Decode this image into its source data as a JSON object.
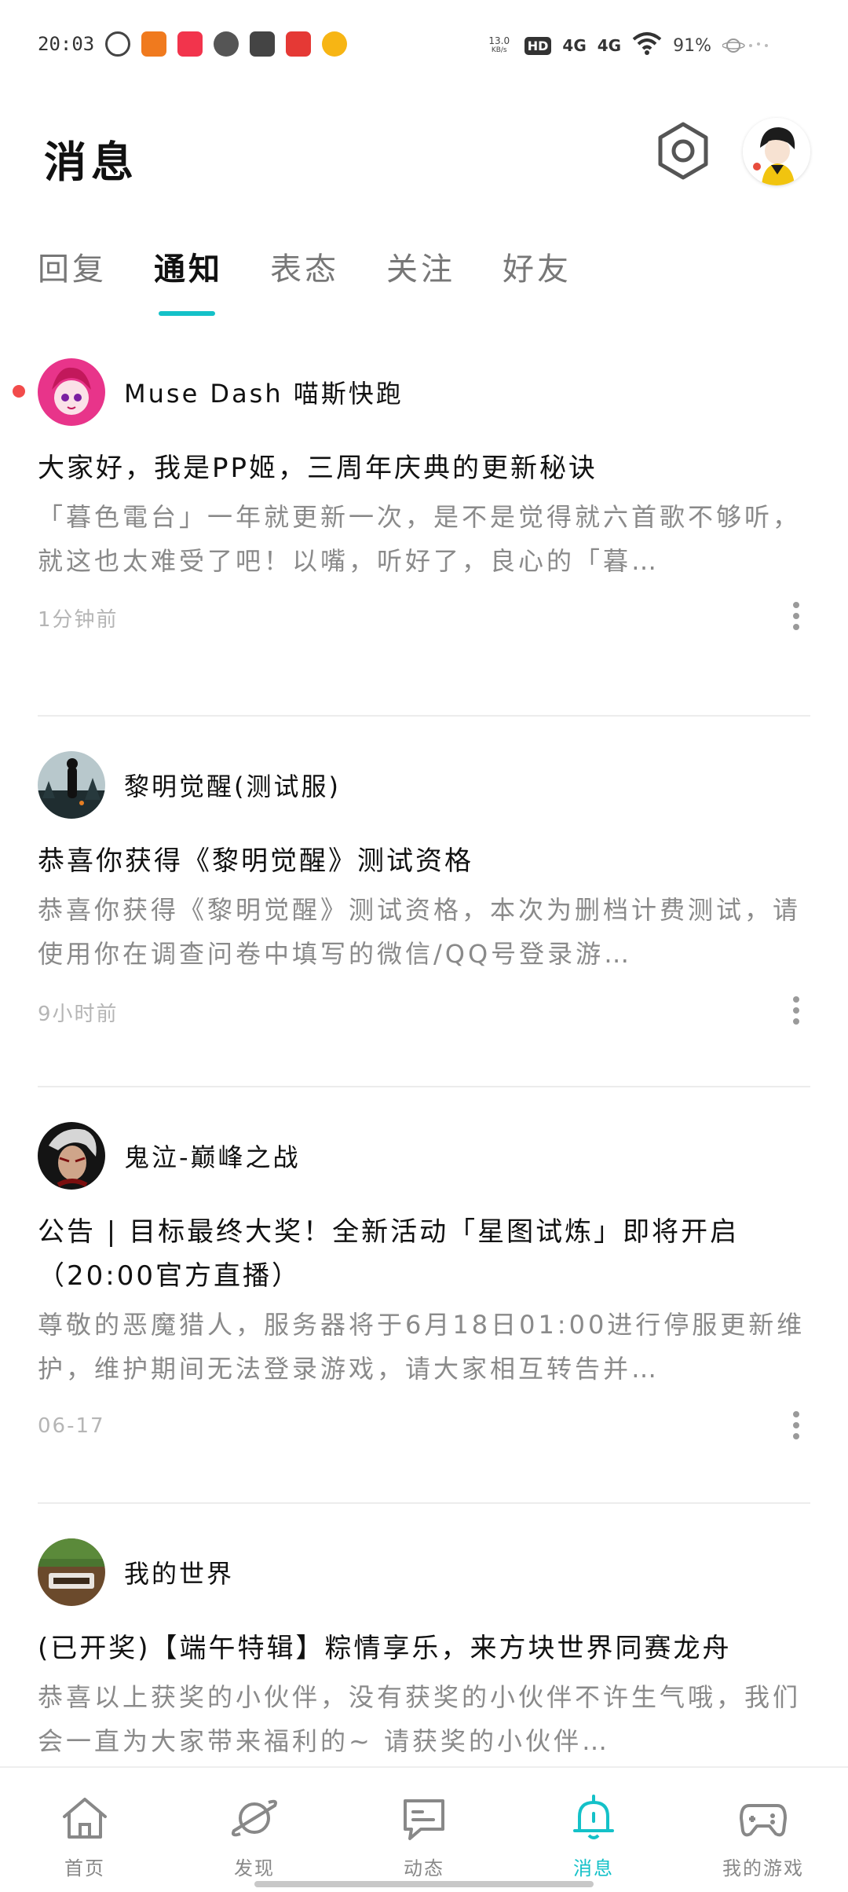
{
  "status_bar": {
    "time": "20:03",
    "net_speed": "13.0",
    "net_speed_unit": "KB/s",
    "hd": "HD",
    "signal_1": "4G",
    "signal_2": "4G",
    "battery": "91%",
    "app_icons": [
      {
        "name": "netease-music-icon",
        "color": "#444444"
      },
      {
        "name": "app-orange-icon",
        "color": "#f07a1e"
      },
      {
        "name": "xiaohongshu-icon",
        "color": "#f2344c"
      },
      {
        "name": "wechat-icon",
        "color": "#444444"
      },
      {
        "name": "mail-icon",
        "color": "#444444"
      },
      {
        "name": "app-red-icon",
        "color": "#e53935"
      },
      {
        "name": "app-yellow-icon",
        "color": "#f7b514"
      }
    ]
  },
  "header": {
    "title": "消息"
  },
  "tabs": [
    {
      "label": "回复",
      "active": false
    },
    {
      "label": "通知",
      "active": true
    },
    {
      "label": "表态",
      "active": false
    },
    {
      "label": "关注",
      "active": false
    },
    {
      "label": "好友",
      "active": false
    }
  ],
  "notifications": [
    {
      "source": "Muse Dash 喵斯快跑",
      "unread": true,
      "title": "大家好，我是PP姬，三周年庆典的更新秘诀",
      "body": "「暮色電台」一年就更新一次，是不是觉得就六首歌不够听，就这也太难受了吧！以嘴，听好了，良心的「暮…",
      "time": "1分钟前",
      "avatar_color": "#e8348a"
    },
    {
      "source": "黎明觉醒(测试服)",
      "unread": false,
      "title": "恭喜你获得《黎明觉醒》测试资格",
      "body": "恭喜你获得《黎明觉醒》测试资格，本次为删档计费测试，请使用你在调查问卷中填写的微信/QQ号登录游…",
      "time": "9小时前",
      "avatar_color": "#2c3e42"
    },
    {
      "source": "鬼泣-巅峰之战",
      "unread": false,
      "title": "公告 | 目标最终大奖！全新活动「星图试炼」即将开启（20:00官方直播）",
      "body": "尊敬的恶魔猎人，服务器将于6月18日01:00进行停服更新维护，维护期间无法登录游戏，请大家相互转告并…",
      "time": "06-17",
      "avatar_color": "#1e1e1e"
    },
    {
      "source": "我的世界",
      "unread": false,
      "title": "(已开奖)【端午特辑】粽情享乐，来方块世界同赛龙舟",
      "body": "恭喜以上获奖的小伙伴，没有获奖的小伙伴不许生气哦，我们会一直为大家带来福利的~ 请获奖的小伙伴…",
      "time": "",
      "avatar_color": "#5b8a3a"
    }
  ],
  "bottom_nav": [
    {
      "label": "首页",
      "icon": "home-icon",
      "active": false
    },
    {
      "label": "发现",
      "icon": "planet-icon",
      "active": false
    },
    {
      "label": "动态",
      "icon": "chat-icon",
      "active": false
    },
    {
      "label": "消息",
      "icon": "bell-icon",
      "active": true
    },
    {
      "label": "我的游戏",
      "icon": "gamepad-icon",
      "active": false
    }
  ],
  "colors": {
    "accent": "#14c1c8",
    "unread": "#f24b4b",
    "muted_text": "#8a8a8a"
  }
}
